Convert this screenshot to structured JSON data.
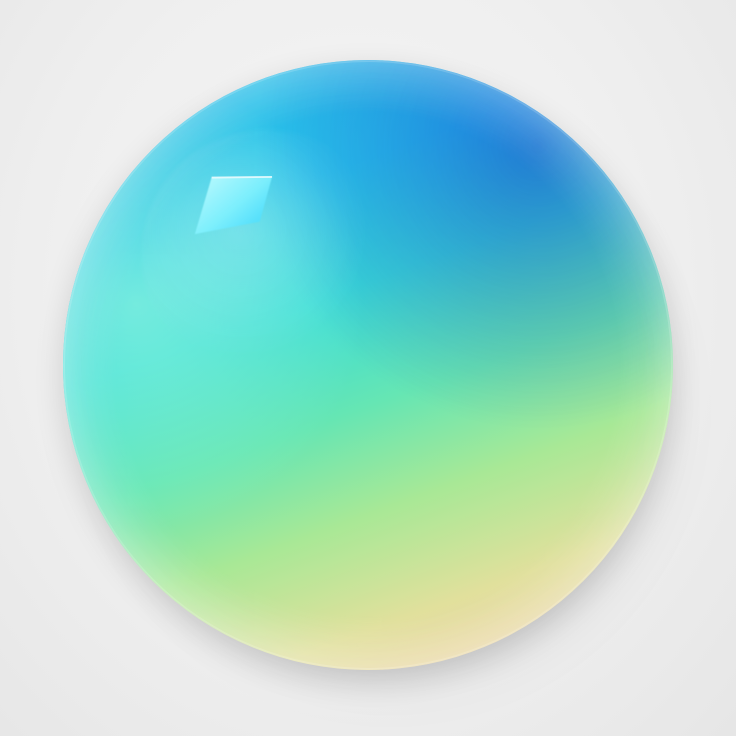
{
  "image": {
    "subject": "iridescent-sphere",
    "colors": {
      "background": "#efefef",
      "sphere_top": "#27b6e8",
      "sphere_mid": "#39dbd8",
      "sphere_lower": "#a8e896",
      "sphere_bottom": "#f6c8a6",
      "sphere_top_right_tint": "#7a63e6",
      "highlight": "#8ff7ff"
    }
  }
}
